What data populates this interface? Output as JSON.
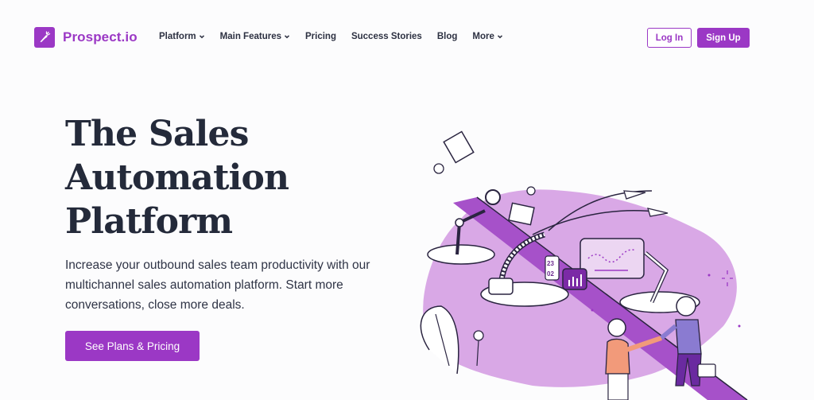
{
  "brand": {
    "name": "Prospect.io",
    "color": "#9b38c5",
    "logo_icon": "carrot-icon"
  },
  "nav": {
    "items": [
      {
        "label": "Platform",
        "has_dropdown": true
      },
      {
        "label": "Main Features",
        "has_dropdown": true
      },
      {
        "label": "Pricing",
        "has_dropdown": false
      },
      {
        "label": "Success Stories",
        "has_dropdown": false
      },
      {
        "label": "Blog",
        "has_dropdown": false
      },
      {
        "label": "More",
        "has_dropdown": true
      }
    ],
    "login_label": "Log In",
    "signup_label": "Sign Up"
  },
  "hero": {
    "title_lines": [
      "The Sales",
      "Automation",
      "Platform"
    ],
    "subtitle": "Increase your outbound sales team productivity with our multichannel sales automation platform. Start more conversations, close more deals.",
    "cta_label": "See Plans & Pricing",
    "illustration": {
      "description": "sales-automation-conveyor-illustration",
      "calendar_text": [
        "23",
        "02"
      ]
    }
  }
}
